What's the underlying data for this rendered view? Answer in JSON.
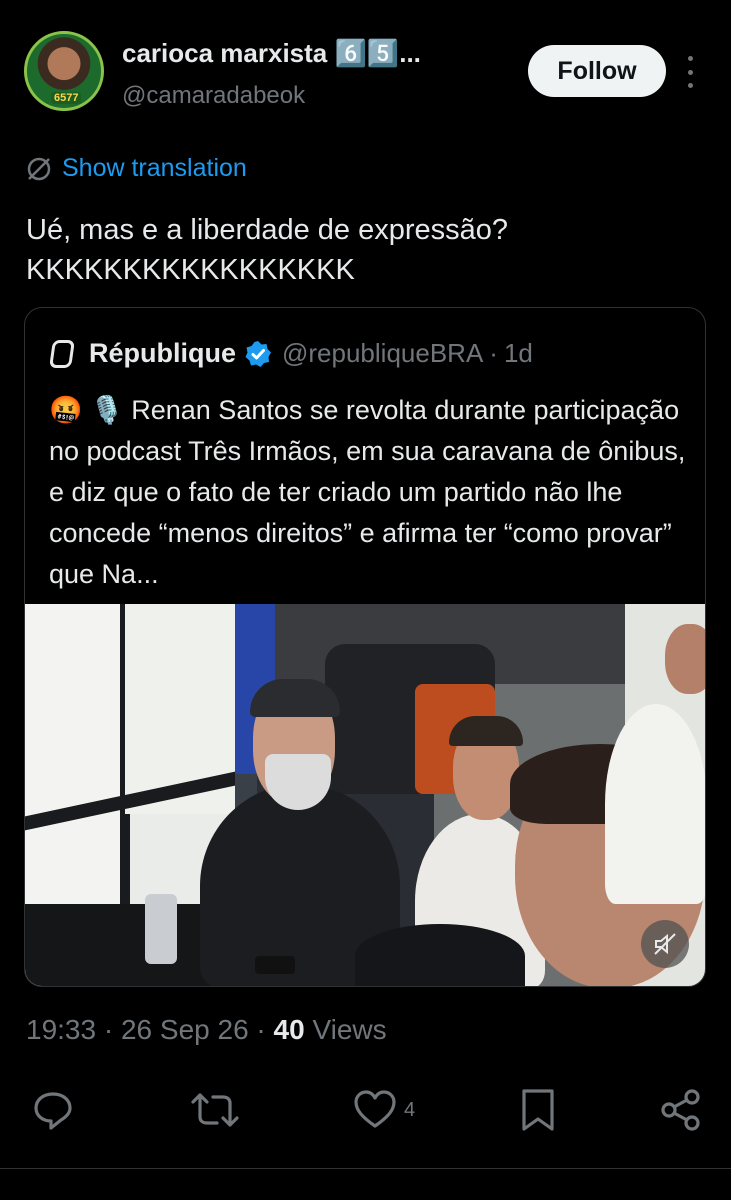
{
  "author": {
    "display_name": "carioca marxista 6️⃣5️⃣...",
    "handle": "@camaradabeok",
    "avatar_badge": "6577"
  },
  "follow_label": "Follow",
  "translation_label": "Show translation",
  "tweet_text": "Ué, mas e a liberdade de expressão?\nKKKKKKKKKKKKKKKKK",
  "quoted": {
    "name": "République",
    "handle": "@republiqueBRA",
    "dot": "·",
    "time": "1d",
    "text": "🤬 🎙️ Renan Santos se revolta durante participação no podcast Três Irmãos, em sua caravana de ônibus, e diz que o fato de ter criado um partido não lhe concede “menos direitos” e afirma ter “como provar” que Na..."
  },
  "meta": {
    "time": "19:33",
    "sep1": "·",
    "date": "26 Sep 26",
    "sep2": "·",
    "views_count": "40",
    "views_label": "Views"
  },
  "actions": {
    "like_count": "4"
  },
  "colors": {
    "background": "#000000",
    "accent": "#1d9bf0",
    "muted_text": "#71767b",
    "primary_text": "#e7e9ea"
  },
  "icons": [
    "translate-icon",
    "verified-icon",
    "mute-icon",
    "reply-icon",
    "retweet-icon",
    "like-icon",
    "bookmark-icon",
    "share-icon"
  ]
}
